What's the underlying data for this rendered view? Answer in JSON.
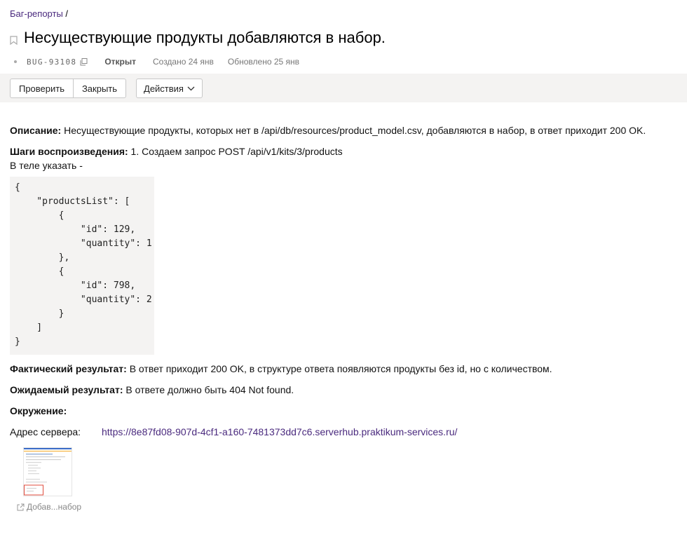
{
  "breadcrumb": {
    "link": "Баг-репорты",
    "separator": " /"
  },
  "issue": {
    "title": "Несуществующие продукты добавляются в набор.",
    "key": "BUG-93108",
    "status": "Открыт",
    "created": "Создано 24 янв",
    "updated": "Обновлено 25 янв"
  },
  "toolbar": {
    "check_label": "Проверить",
    "close_label": "Закрыть",
    "actions_label": "Действия"
  },
  "description": {
    "label": "Описание:",
    "text": " Несуществующие продукты, которых нет в /api/db/resources/product_model.csv, добавляются в набор, в ответ приходит 200 OK."
  },
  "steps": {
    "label": "Шаги воспроизведения:",
    "line1": " 1. Создаем запрос POST /api/v1/kits/3/products",
    "line2": "В теле указать -",
    "code": "{\n    \"productsList\": [\n        {\n            \"id\": 129,\n            \"quantity\": 1\n        },\n        {\n            \"id\": 798,\n            \"quantity\": 2\n        }\n    ]\n}"
  },
  "actual": {
    "label": "Фактический результат:",
    "text": " В ответ приходит 200 OK, в структуре ответа появляются продукты без id, но с количеством."
  },
  "expected": {
    "label": "Ожидаемый результат:",
    "text": " В ответе должно быть 404 Not found."
  },
  "environment": {
    "label": "Окружение:",
    "server_label": "Адрес сервера:",
    "server_url": "https://8e87fd08-907d-4cf1-a160-7481373dd7c6.serverhub.praktikum-services.ru/"
  },
  "attachment": {
    "caption": "Добав...набор"
  },
  "colors": {
    "link": "#4a2a7e",
    "toolbar_bg": "#f4f3f2",
    "code_bg": "#f4f3f2"
  }
}
